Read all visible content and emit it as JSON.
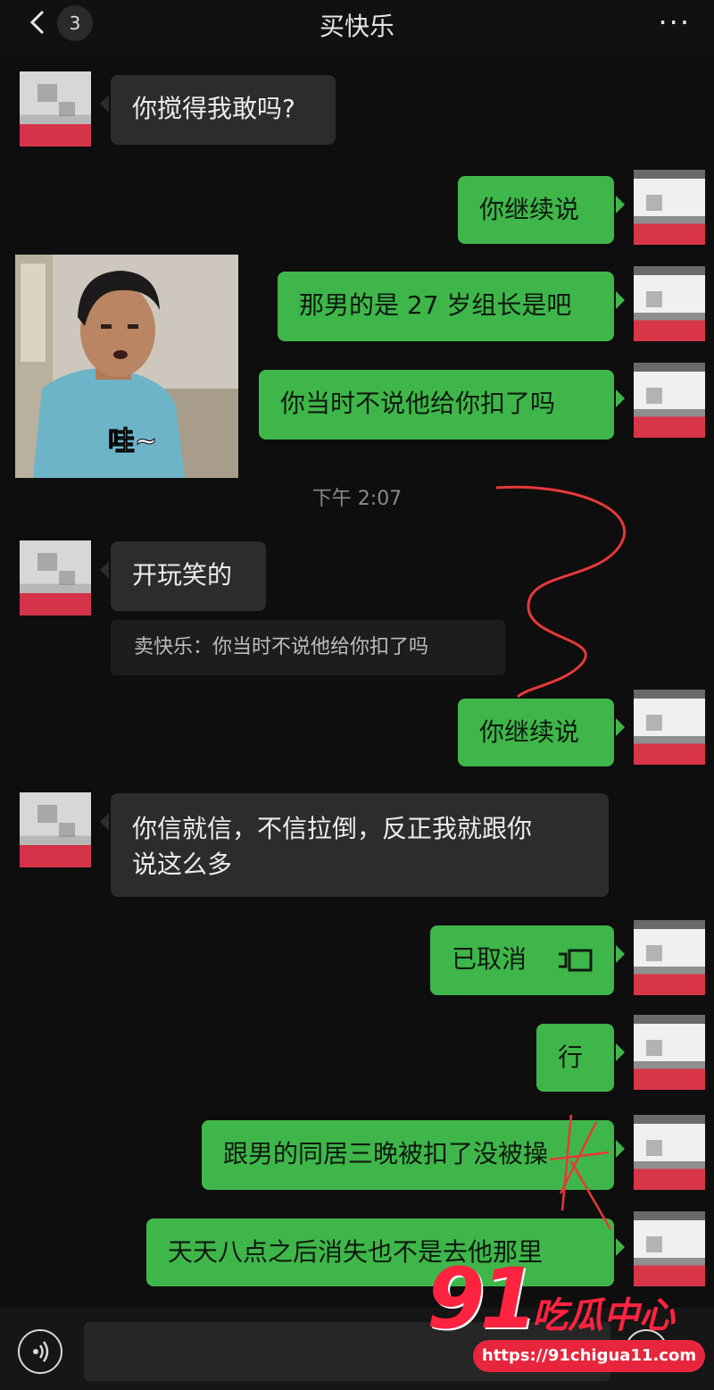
{
  "header": {
    "title": "买快乐",
    "unread_count": "3",
    "more": "···"
  },
  "messages": [
    {
      "side": "in",
      "text": "你搅得我敢吗?"
    },
    {
      "side": "out",
      "text": "你继续说"
    },
    {
      "side": "out",
      "text": "那男的是 27 岁组长是吧"
    },
    {
      "side": "out",
      "text": "你当时不说他给你扣了吗"
    },
    {
      "side": "in",
      "type": "sticker",
      "caption": "哇~"
    },
    {
      "side": "in",
      "text": "开玩笑的"
    },
    {
      "side": "out",
      "text": "你继续说"
    },
    {
      "side": "in",
      "text_line1": "你信就信，不信拉倒，反正我就跟你",
      "text_line2": "说这么多"
    },
    {
      "side": "out",
      "text": "已取消",
      "icon": "phone-cancelled-icon"
    },
    {
      "side": "out",
      "text": "行"
    },
    {
      "side": "out",
      "text": "跟男的同居三晚被扣了没被操"
    },
    {
      "side": "out",
      "text": "天天八点之后消失也不是去他那里"
    }
  ],
  "quote": {
    "text": "卖快乐：你当时不说他给你扣了吗"
  },
  "timestamp": "下午 2:07",
  "watermark": {
    "number": "91",
    "name": "吃瓜中心",
    "url": "https://91chigua11.com"
  },
  "colors": {
    "outgoing_bubble": "#3fb64a",
    "incoming_bubble": "#2c2c2c",
    "annotation": "#e8383a",
    "watermark": "#ff2340"
  }
}
